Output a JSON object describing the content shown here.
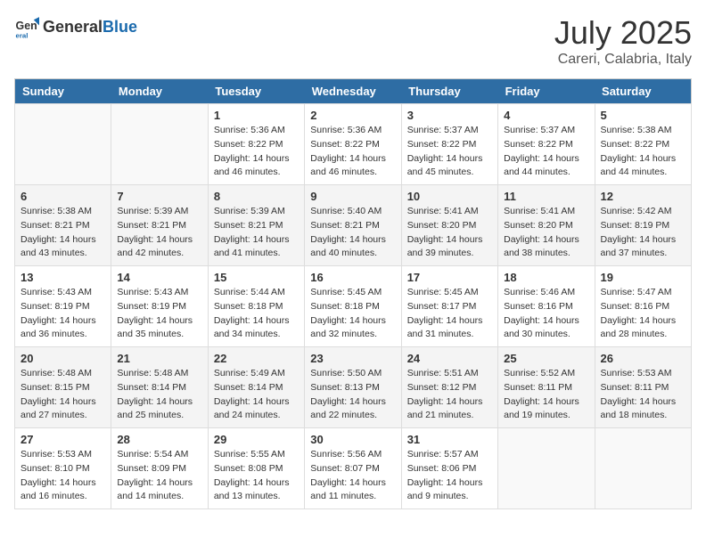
{
  "header": {
    "logo_general": "General",
    "logo_blue": "Blue",
    "month": "July 2025",
    "location": "Careri, Calabria, Italy"
  },
  "weekdays": [
    "Sunday",
    "Monday",
    "Tuesday",
    "Wednesday",
    "Thursday",
    "Friday",
    "Saturday"
  ],
  "weeks": [
    [
      {
        "day": "",
        "sunrise": "",
        "sunset": "",
        "daylight": ""
      },
      {
        "day": "",
        "sunrise": "",
        "sunset": "",
        "daylight": ""
      },
      {
        "day": "1",
        "sunrise": "Sunrise: 5:36 AM",
        "sunset": "Sunset: 8:22 PM",
        "daylight": "Daylight: 14 hours and 46 minutes."
      },
      {
        "day": "2",
        "sunrise": "Sunrise: 5:36 AM",
        "sunset": "Sunset: 8:22 PM",
        "daylight": "Daylight: 14 hours and 46 minutes."
      },
      {
        "day": "3",
        "sunrise": "Sunrise: 5:37 AM",
        "sunset": "Sunset: 8:22 PM",
        "daylight": "Daylight: 14 hours and 45 minutes."
      },
      {
        "day": "4",
        "sunrise": "Sunrise: 5:37 AM",
        "sunset": "Sunset: 8:22 PM",
        "daylight": "Daylight: 14 hours and 44 minutes."
      },
      {
        "day": "5",
        "sunrise": "Sunrise: 5:38 AM",
        "sunset": "Sunset: 8:22 PM",
        "daylight": "Daylight: 14 hours and 44 minutes."
      }
    ],
    [
      {
        "day": "6",
        "sunrise": "Sunrise: 5:38 AM",
        "sunset": "Sunset: 8:21 PM",
        "daylight": "Daylight: 14 hours and 43 minutes."
      },
      {
        "day": "7",
        "sunrise": "Sunrise: 5:39 AM",
        "sunset": "Sunset: 8:21 PM",
        "daylight": "Daylight: 14 hours and 42 minutes."
      },
      {
        "day": "8",
        "sunrise": "Sunrise: 5:39 AM",
        "sunset": "Sunset: 8:21 PM",
        "daylight": "Daylight: 14 hours and 41 minutes."
      },
      {
        "day": "9",
        "sunrise": "Sunrise: 5:40 AM",
        "sunset": "Sunset: 8:21 PM",
        "daylight": "Daylight: 14 hours and 40 minutes."
      },
      {
        "day": "10",
        "sunrise": "Sunrise: 5:41 AM",
        "sunset": "Sunset: 8:20 PM",
        "daylight": "Daylight: 14 hours and 39 minutes."
      },
      {
        "day": "11",
        "sunrise": "Sunrise: 5:41 AM",
        "sunset": "Sunset: 8:20 PM",
        "daylight": "Daylight: 14 hours and 38 minutes."
      },
      {
        "day": "12",
        "sunrise": "Sunrise: 5:42 AM",
        "sunset": "Sunset: 8:19 PM",
        "daylight": "Daylight: 14 hours and 37 minutes."
      }
    ],
    [
      {
        "day": "13",
        "sunrise": "Sunrise: 5:43 AM",
        "sunset": "Sunset: 8:19 PM",
        "daylight": "Daylight: 14 hours and 36 minutes."
      },
      {
        "day": "14",
        "sunrise": "Sunrise: 5:43 AM",
        "sunset": "Sunset: 8:19 PM",
        "daylight": "Daylight: 14 hours and 35 minutes."
      },
      {
        "day": "15",
        "sunrise": "Sunrise: 5:44 AM",
        "sunset": "Sunset: 8:18 PM",
        "daylight": "Daylight: 14 hours and 34 minutes."
      },
      {
        "day": "16",
        "sunrise": "Sunrise: 5:45 AM",
        "sunset": "Sunset: 8:18 PM",
        "daylight": "Daylight: 14 hours and 32 minutes."
      },
      {
        "day": "17",
        "sunrise": "Sunrise: 5:45 AM",
        "sunset": "Sunset: 8:17 PM",
        "daylight": "Daylight: 14 hours and 31 minutes."
      },
      {
        "day": "18",
        "sunrise": "Sunrise: 5:46 AM",
        "sunset": "Sunset: 8:16 PM",
        "daylight": "Daylight: 14 hours and 30 minutes."
      },
      {
        "day": "19",
        "sunrise": "Sunrise: 5:47 AM",
        "sunset": "Sunset: 8:16 PM",
        "daylight": "Daylight: 14 hours and 28 minutes."
      }
    ],
    [
      {
        "day": "20",
        "sunrise": "Sunrise: 5:48 AM",
        "sunset": "Sunset: 8:15 PM",
        "daylight": "Daylight: 14 hours and 27 minutes."
      },
      {
        "day": "21",
        "sunrise": "Sunrise: 5:48 AM",
        "sunset": "Sunset: 8:14 PM",
        "daylight": "Daylight: 14 hours and 25 minutes."
      },
      {
        "day": "22",
        "sunrise": "Sunrise: 5:49 AM",
        "sunset": "Sunset: 8:14 PM",
        "daylight": "Daylight: 14 hours and 24 minutes."
      },
      {
        "day": "23",
        "sunrise": "Sunrise: 5:50 AM",
        "sunset": "Sunset: 8:13 PM",
        "daylight": "Daylight: 14 hours and 22 minutes."
      },
      {
        "day": "24",
        "sunrise": "Sunrise: 5:51 AM",
        "sunset": "Sunset: 8:12 PM",
        "daylight": "Daylight: 14 hours and 21 minutes."
      },
      {
        "day": "25",
        "sunrise": "Sunrise: 5:52 AM",
        "sunset": "Sunset: 8:11 PM",
        "daylight": "Daylight: 14 hours and 19 minutes."
      },
      {
        "day": "26",
        "sunrise": "Sunrise: 5:53 AM",
        "sunset": "Sunset: 8:11 PM",
        "daylight": "Daylight: 14 hours and 18 minutes."
      }
    ],
    [
      {
        "day": "27",
        "sunrise": "Sunrise: 5:53 AM",
        "sunset": "Sunset: 8:10 PM",
        "daylight": "Daylight: 14 hours and 16 minutes."
      },
      {
        "day": "28",
        "sunrise": "Sunrise: 5:54 AM",
        "sunset": "Sunset: 8:09 PM",
        "daylight": "Daylight: 14 hours and 14 minutes."
      },
      {
        "day": "29",
        "sunrise": "Sunrise: 5:55 AM",
        "sunset": "Sunset: 8:08 PM",
        "daylight": "Daylight: 14 hours and 13 minutes."
      },
      {
        "day": "30",
        "sunrise": "Sunrise: 5:56 AM",
        "sunset": "Sunset: 8:07 PM",
        "daylight": "Daylight: 14 hours and 11 minutes."
      },
      {
        "day": "31",
        "sunrise": "Sunrise: 5:57 AM",
        "sunset": "Sunset: 8:06 PM",
        "daylight": "Daylight: 14 hours and 9 minutes."
      },
      {
        "day": "",
        "sunrise": "",
        "sunset": "",
        "daylight": ""
      },
      {
        "day": "",
        "sunrise": "",
        "sunset": "",
        "daylight": ""
      }
    ]
  ]
}
